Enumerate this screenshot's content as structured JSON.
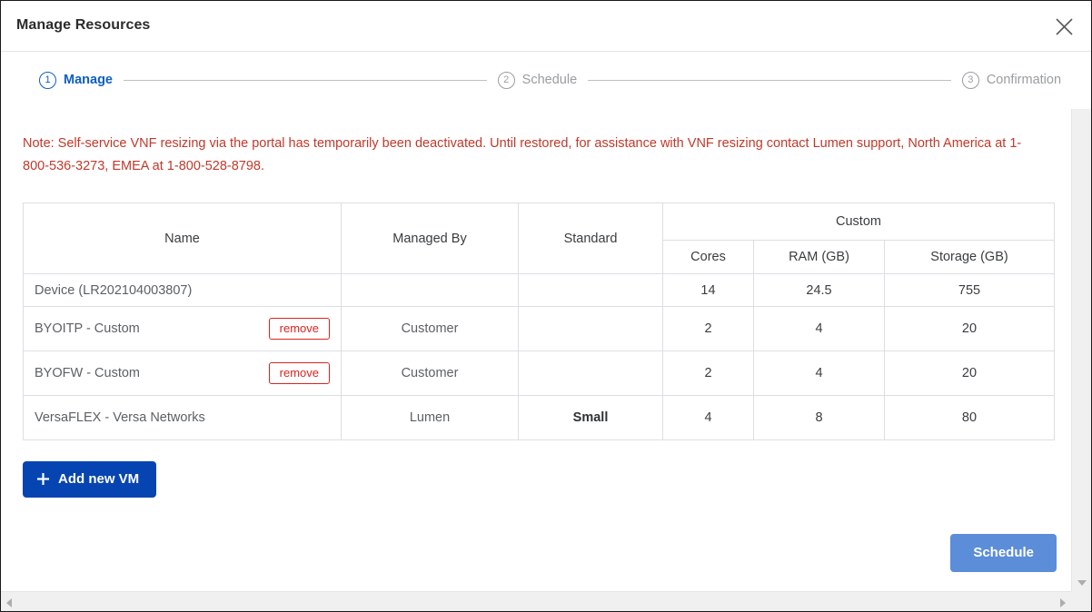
{
  "dialog": {
    "title": "Manage Resources",
    "close_icon": "close-icon"
  },
  "stepper": {
    "steps": [
      {
        "number": "1",
        "label": "Manage",
        "state": "active"
      },
      {
        "number": "2",
        "label": "Schedule",
        "state": "inactive"
      },
      {
        "number": "3",
        "label": "Confirmation",
        "state": "inactive"
      }
    ]
  },
  "note": {
    "color": "#c0392b",
    "text": "Note: Self-service VNF resizing via the portal has temporarily been deactivated. Until restored, for assistance with VNF resizing contact Lumen support, North America at 1-800-536-3273, EMEA at 1-800-528-8798."
  },
  "table": {
    "group_headers": {
      "name": "Name",
      "managed_by": "Managed By",
      "standard": "Standard",
      "custom": "Custom"
    },
    "sub_headers": {
      "cores": "Cores",
      "ram": "RAM (GB)",
      "storage": "Storage (GB)"
    },
    "rows": [
      {
        "name": "Device (LR202104003807)",
        "remove_label": "",
        "has_remove": false,
        "managed_by": "",
        "standard": "",
        "cores": "14",
        "ram": "24.5",
        "storage": "755"
      },
      {
        "name": "BYOITP - Custom",
        "remove_label": "remove",
        "has_remove": true,
        "managed_by": "Customer",
        "standard": "",
        "cores": "2",
        "ram": "4",
        "storage": "20"
      },
      {
        "name": "BYOFW - Custom",
        "remove_label": "remove",
        "has_remove": true,
        "managed_by": "Customer",
        "standard": "",
        "cores": "2",
        "ram": "4",
        "storage": "20"
      },
      {
        "name": "VersaFLEX - Versa Networks",
        "remove_label": "",
        "has_remove": false,
        "managed_by": "Lumen",
        "standard": "Small",
        "cores": "4",
        "ram": "8",
        "storage": "80"
      }
    ]
  },
  "actions": {
    "add_vm_label": "Add new VM",
    "add_vm_icon": "plus-icon",
    "add_vm_color": "#0645b1",
    "schedule_label": "Schedule",
    "schedule_color": "#5b8dd9"
  },
  "scrollbars": {
    "vertical_up_icon": "scroll-up-arrow-icon",
    "vertical_down_icon": "scroll-down-arrow-icon",
    "horizontal_left_icon": "scroll-left-arrow-icon",
    "horizontal_right_icon": "scroll-right-arrow-icon"
  }
}
